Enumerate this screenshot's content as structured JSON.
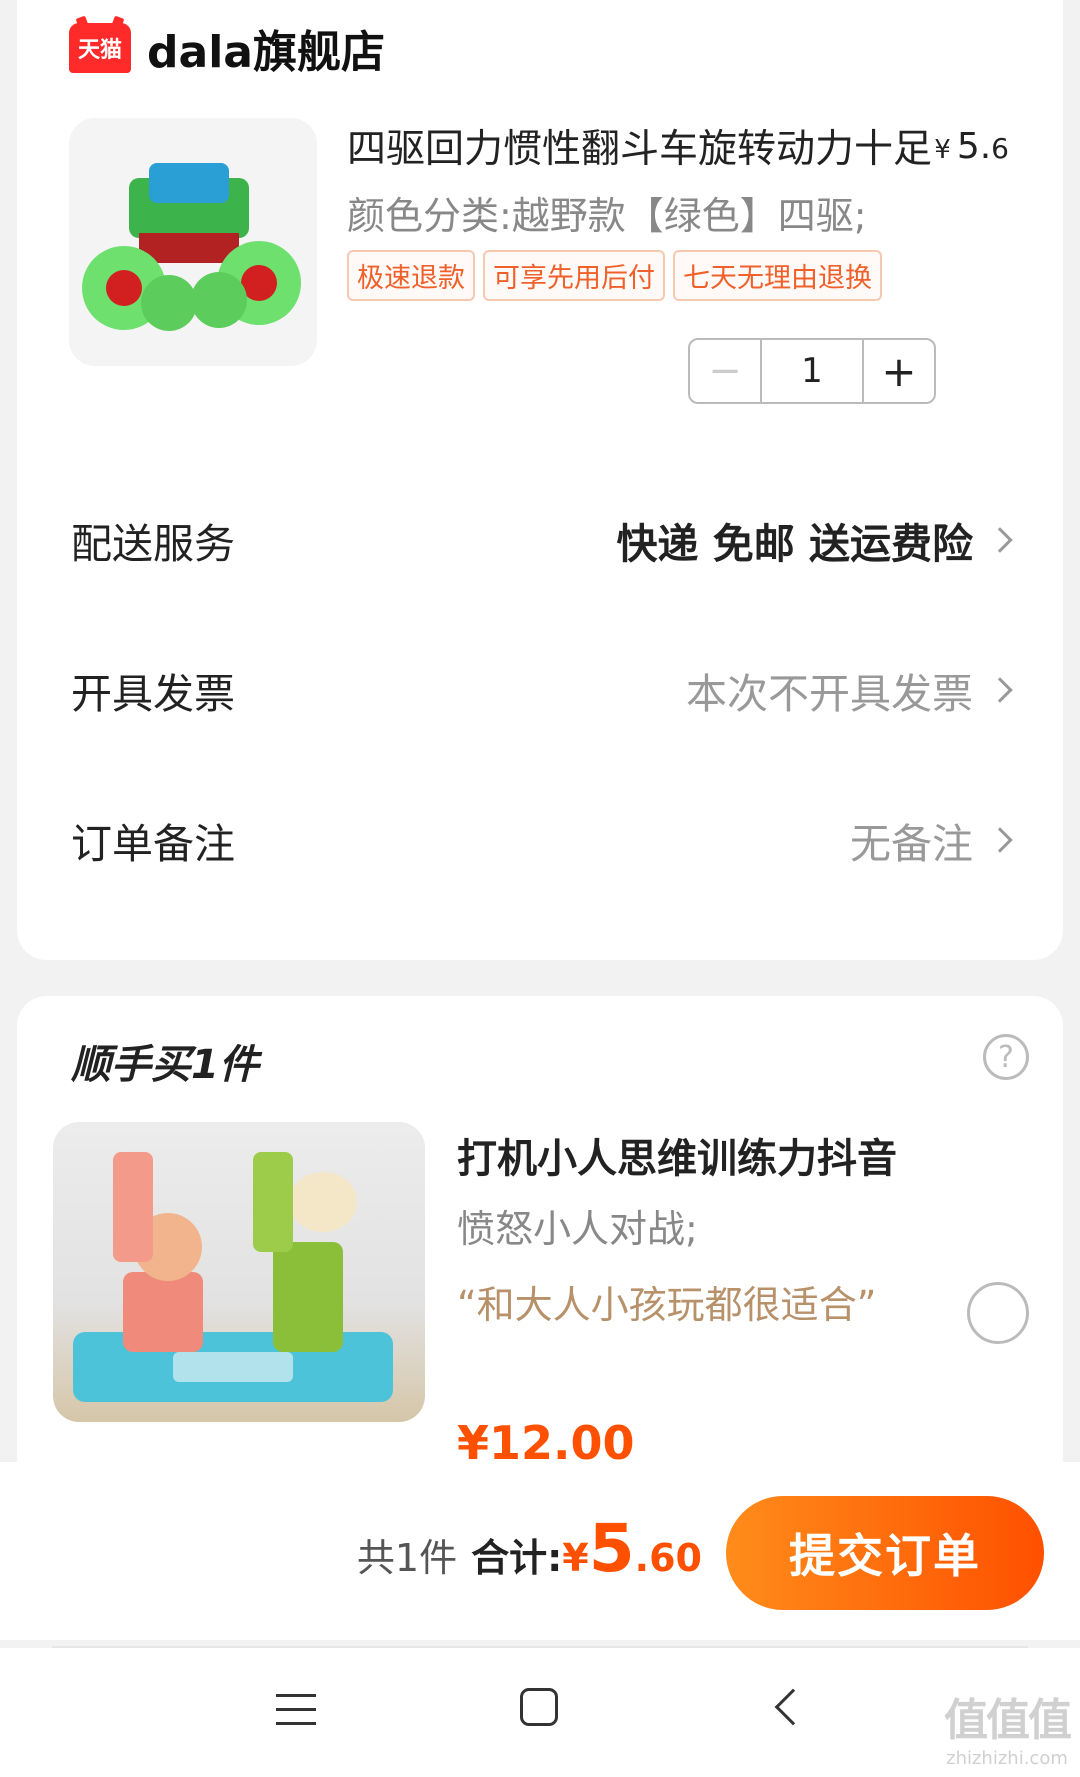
{
  "shop": {
    "badge": "天猫",
    "name": "dala旗舰店"
  },
  "product": {
    "title": "四驱回力惯性翻斗车旋转动力十足",
    "price_yen": "¥",
    "price_int": "5.",
    "price_dec": "6",
    "sku": "颜色分类:越野款【绿色】四驱;",
    "tags": [
      "极速退款",
      "可享先用后付",
      "七天无理由退换"
    ],
    "quantity": "1",
    "minus": "−",
    "plus": "+"
  },
  "rows": {
    "delivery": {
      "label": "配送服务",
      "value": "快递 免邮 送运费险"
    },
    "invoice": {
      "label": "开具发票",
      "value": "本次不开具发票"
    },
    "note": {
      "label": "订单备注",
      "value": "无备注"
    }
  },
  "addon": {
    "title": "顺手买1件",
    "help": "?",
    "name": "打机小人思维训练力抖音",
    "sku": "愤怒小人对战;",
    "quote": "“和大人小孩玩都很适合”",
    "price_fragment": "¥12.00"
  },
  "footer": {
    "count": "共1件",
    "total_label": "合计:",
    "total_yen": "¥",
    "total_int": "5",
    "total_dec": ".60",
    "submit": "提交订单"
  },
  "watermark": {
    "big": "值值值",
    "small": "zhizhizhi.com"
  },
  "colors": {
    "accent": "#ff5000",
    "accent_start": "#ff8c1a",
    "tmall": "#ff2b2b",
    "quote": "#b6916a"
  }
}
